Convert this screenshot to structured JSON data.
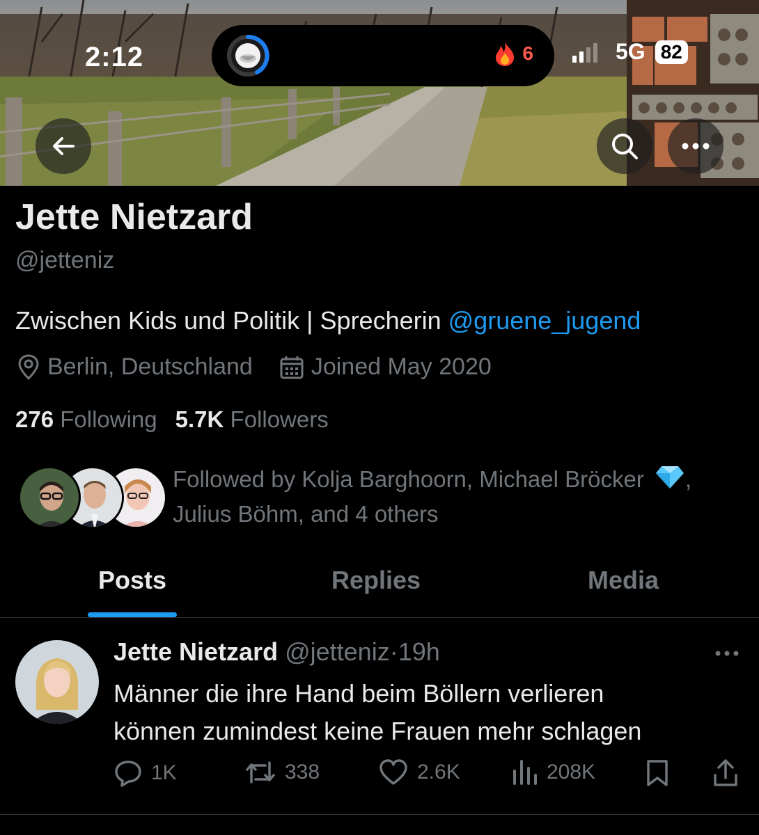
{
  "status_bar": {
    "time": "2:12",
    "streak_count": "6",
    "network": "5G",
    "battery": "82"
  },
  "profile": {
    "name": "Jette Nietzard",
    "handle": "@jetteniz",
    "bio_text": "Zwischen Kids und Politik | Sprecherin ",
    "bio_mention": "@gruene_jugend",
    "location": "Berlin, Deutschland",
    "joined": "Joined May 2020",
    "following_count": "276",
    "following_label": "Following",
    "followers_count": "5.7K",
    "followers_label": "Followers",
    "followed_by_prefix": "Followed by Kolja Barghoorn, Michael Bröcker",
    "followed_by_suffix": "Julius Böhm, and 4 others"
  },
  "tabs": [
    {
      "label": "Posts",
      "active": true
    },
    {
      "label": "Replies",
      "active": false
    },
    {
      "label": "Media",
      "active": false
    }
  ],
  "post": {
    "author_name": "Jette Nietzard",
    "author_handle": "@jetteniz",
    "separator": "·",
    "time": "19h",
    "text_line1": "Männer die ihre Hand beim Böllern verlieren",
    "text_line2": "können zumindest keine Frauen mehr schlagen",
    "replies": "1K",
    "reposts": "338",
    "likes": "2.6K",
    "views": "208K"
  },
  "colors": {
    "accent": "#1d9bf0",
    "muted": "#71767b",
    "text": "#e7e9ea",
    "background": "#000000"
  },
  "icons": [
    "back-arrow-icon",
    "search-icon",
    "more-icon",
    "location-icon",
    "calendar-icon",
    "verified-diamond-icon",
    "reply-icon",
    "repost-icon",
    "like-icon",
    "views-icon",
    "bookmark-icon",
    "share-icon",
    "fire-icon"
  ]
}
